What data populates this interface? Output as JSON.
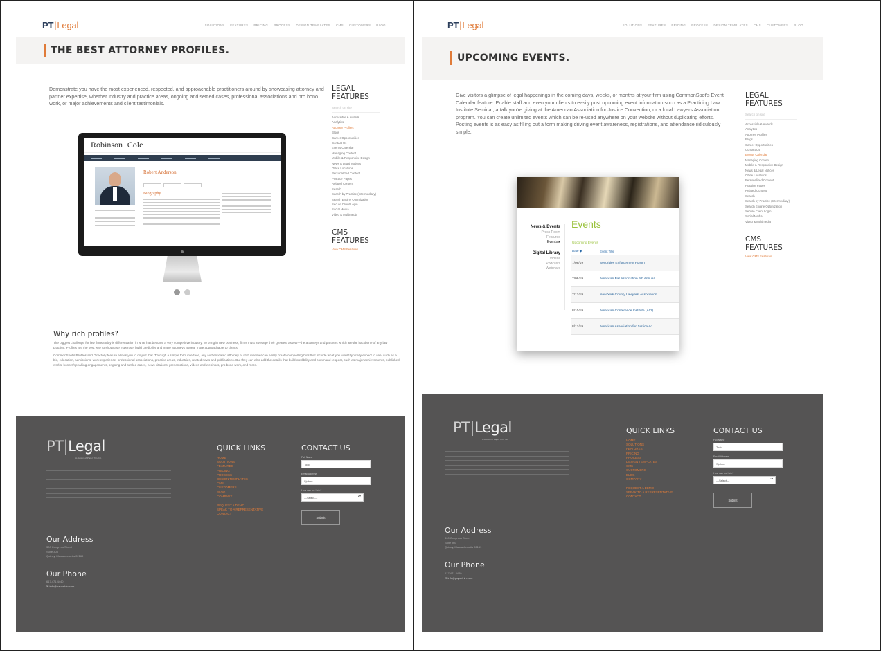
{
  "nav": {
    "logo_pt": "PT",
    "logo_word": "Legal",
    "links": [
      "Solutions",
      "Features",
      "Pricing",
      "Process",
      "Design Templates",
      "CMS",
      "Customers",
      "Blog"
    ]
  },
  "left_page": {
    "title": "THE BEST ATTORNEY PROFILES.",
    "intro": "Demonstrate you have the most experienced, respected, and approachable practitioners around by showcasing attorney and partner expertise, whether industry and practice areas, ongoing and settled cases, professional associations and pro bono work, or major achievements and client testimonials.",
    "screen_logo": "Robinson+Cole",
    "screen_name": "Robert Anderson",
    "screen_bio": "Biography",
    "why_heading": "Why rich profiles?",
    "why_p1": "The biggest challenge for law firms today is differentiation in what has become a very competitive industry. To bring in new business, firms must leverage their greatest assets—the attorneys and partners which are the backbone of any law practice. Profiles are the best way to showcase expertise, build credibility and make attorneys appear more approachable to clients.",
    "why_p2": "CommonSpot's Profiles and Directory feature allows you to do just that. Through a simple form interface, any authenticated attorney or staff member can easily create compelling bios that include what you would typically expect to see, such as a bio, education, admissions, work experience, professional associations, practice areas, industries, related news and publications. But they can also add the details that build credibility and command respect, such as major achievements, published works, honors/speaking engagements, ongoing and settled cases, news citations, presentations, videos and webinars, pro bono work, and more."
  },
  "right_page": {
    "title": "UPCOMING EVENTS.",
    "intro": "Give visitors a glimpse of legal happenings in the coming days, weeks, or months at your firm using CommonSpot's Event Calendar feature. Enable staff and even your clients to easily post upcoming event information such as a Practicing Law Institute Seminar, a talk you're giving at the American Association for Justice Convention, or a local Lawyers Association program. You can create unlimited events which can be re-used anywhere on your website without duplicating efforts. Posting events is as easy as filling out a form making driving event awareness, registrations, and attendance ridiculously simple.",
    "events": {
      "nav_news": "News & Events",
      "nav_sub": [
        "Press Room",
        "Featured",
        "Events"
      ],
      "nav_lib": "Digital Library",
      "nav_lib_sub": [
        "Videos",
        "Podcasts",
        "Webinars"
      ],
      "title": "Events",
      "upcoming": "Upcoming Events",
      "col_date": "Date",
      "col_title": "Event Title",
      "rows": [
        {
          "date": "7/08/19",
          "name": "Securities Enforcement Forum"
        },
        {
          "date": "7/08/19",
          "name": "American Bar Association 9th Annual"
        },
        {
          "date": "7/17/19",
          "name": "New York County Lawyers' Association"
        },
        {
          "date": "8/10/19",
          "name": "American Conference Institute (ACI)"
        },
        {
          "date": "8/17/19",
          "name": "American Association for Justice Ad"
        }
      ]
    }
  },
  "sidebar": {
    "legal_head_1": "LEGAL",
    "legal_head_2": "FEATURES",
    "search": "Search on site",
    "items": [
      "Accessible & Awards",
      "Analytics",
      "Attorney Profiles",
      "Blogs",
      "Career Opportunities",
      "Contact Us",
      "Events Calendar",
      "Managing Content",
      "Mobile & Responsive Design",
      "News & Legal Notices",
      "Office Locations",
      "Personalized Content",
      "Practice Pages",
      "Related Content",
      "Search",
      "Search by Practice (Intermediary)",
      "Search Engine Optimization",
      "Secure Client Login",
      "Social Media",
      "Video & Multimedia"
    ],
    "cms_head_1": "CMS",
    "cms_head_2": "FEATURES",
    "cms_link": "View CMS Features"
  },
  "footer": {
    "logo_pt": "PT",
    "logo_word": "Legal",
    "tagline": "A division of Paper Thin, Inc.",
    "quick_links_head": "QUICK LINKS",
    "quick_links": [
      "Home",
      "Solutions",
      "Features",
      "Pricing",
      "Process",
      "Design Templates",
      "CMS",
      "Customers",
      "Blog",
      "Company"
    ],
    "extra_links": [
      "Request a Demo",
      "Speak to a Representative",
      "Contact"
    ],
    "contact_head": "CONTACT US",
    "label_name": "Full Name",
    "value_name": "Todd",
    "label_email": "Email Address",
    "value_email": "Sjohnn",
    "label_select": "How can we help?",
    "select_value": "—Select—",
    "submit": "Submit",
    "address_head": "Our Address",
    "address_lines": [
      "300 Congress Street",
      "Suite 303",
      "Quincy, Massachusetts 02169"
    ],
    "phone_head": "Our Phone",
    "phone": "617.471.4440",
    "email": "info@paperthin.com"
  }
}
